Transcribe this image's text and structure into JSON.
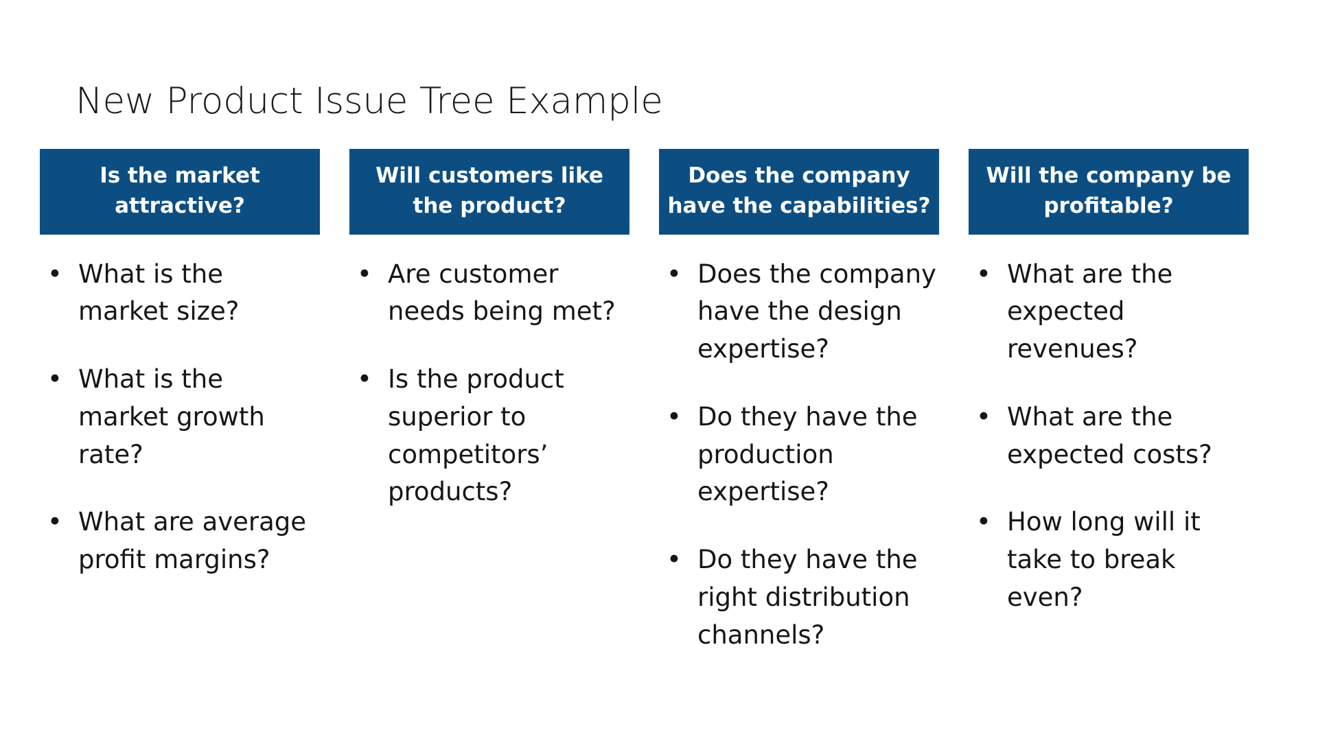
{
  "slide": {
    "title": "New Product Issue Tree Example",
    "background_color": "#ffffff",
    "accent_color": "#0d4e82",
    "text_color": "#161616",
    "bullet_glyph": "•"
  },
  "columns": [
    {
      "header": "Is the market attractive?",
      "bullets": [
        "What is the market size?",
        "What is the market growth rate?",
        "What are average profit margins?"
      ]
    },
    {
      "header": "Will customers like the product?",
      "bullets": [
        "Are customer needs being met?",
        "Is the product superior to competitors’ products?"
      ]
    },
    {
      "header": "Does the company have the capabilities?",
      "bullets": [
        "Does the company have the design expertise?",
        "Do they have the production expertise?",
        "Do they have the right distribution channels?"
      ]
    },
    {
      "header": "Will the company be profitable?",
      "bullets": [
        "What are the expected revenues?",
        "What are the expected costs?",
        "How long will it take to break even?"
      ]
    }
  ]
}
